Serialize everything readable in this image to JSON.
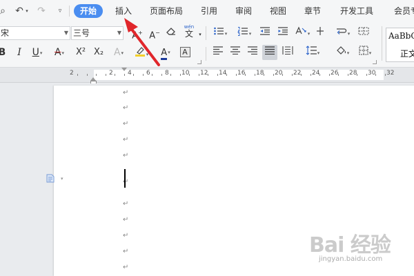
{
  "quick_access": {
    "preview_icon": "print-preview-icon",
    "undo_icon": "undo-icon",
    "redo_icon": "redo-icon",
    "more_icon": "chevron-down-icon"
  },
  "menu": {
    "tabs": [
      "开始",
      "插入",
      "页面布局",
      "引用",
      "审阅",
      "视图",
      "章节",
      "开发工具",
      "会员专"
    ],
    "active_tab": "开始",
    "accent": "#4a8df0"
  },
  "ribbon": {
    "font_name": "宋体",
    "font_name_visible": "宋",
    "font_size": "三号",
    "grow_font": "A",
    "shrink_font": "A",
    "pinyin_label": "wén",
    "pinyin_char": "文",
    "bold": "B",
    "underline": "U",
    "strike": "A",
    "superscript": "X²",
    "subscript": "X₂",
    "text_effect": "A",
    "font_color": "A",
    "char_shading": "A",
    "style_preview": "AaBbCcDd",
    "style_preview_visible": "AaBbC",
    "style_name": "正文"
  },
  "colors": {
    "highlight": "#f3d02a",
    "font_color_bar": "#1a3a9a",
    "strike_color": "#d23b3b",
    "annotation_arrow": "#e0262b"
  },
  "ruler": {
    "labels": [
      "2",
      "2",
      "4",
      "6",
      "8",
      "10",
      "12",
      "14",
      "16",
      "18",
      "20",
      "22",
      "24",
      "26",
      "28",
      "30",
      "32"
    ]
  },
  "document": {
    "paragraph_mark": "↵",
    "paragraph_count": 13
  },
  "watermark": {
    "logo": "Bai 经验",
    "url": "jingyan.baidu.com"
  }
}
